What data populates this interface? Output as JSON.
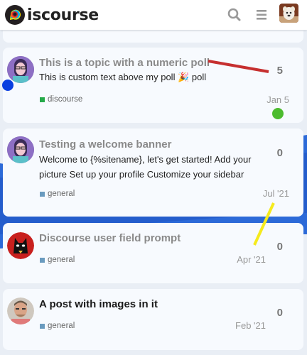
{
  "header": {
    "site_name": "Discourse",
    "logo_word": "iscourse",
    "icons": [
      "search-icon",
      "hamburger-menu-icon",
      "user-avatar"
    ]
  },
  "topics": [
    {
      "title": "This is a topic with a numeric poll",
      "excerpt_before": "This is custom text above my poll",
      "excerpt_emoji": "🎉",
      "excerpt_after": "poll",
      "category": "discourse",
      "category_color": "#25aa4a",
      "replies": "5",
      "date": "Jan 5",
      "unread": false
    },
    {
      "title": "Testing a welcome banner",
      "excerpt": "Welcome to {%sitename}, let's get started! Add your picture Set up your profile Customize your sidebar",
      "category": "general",
      "category_color": "#6a9bbf",
      "replies": "0",
      "date": "Jul '21",
      "unread": false
    },
    {
      "title": "Discourse user field prompt",
      "category": "general",
      "category_color": "#6a9bbf",
      "replies": "0",
      "date": "Apr '21",
      "unread": false
    },
    {
      "title": "A post with images in it",
      "category": "general",
      "category_color": "#6a9bbf",
      "replies": "0",
      "date": "Feb '21",
      "unread": true
    }
  ],
  "colors": {
    "accent_blue": "#1e5fd6",
    "annotation_red": "#c62f2f",
    "annotation_yellow": "#f5ea1c",
    "annotation_green": "#4cbb2e",
    "annotation_blue": "#0a3fe0"
  }
}
